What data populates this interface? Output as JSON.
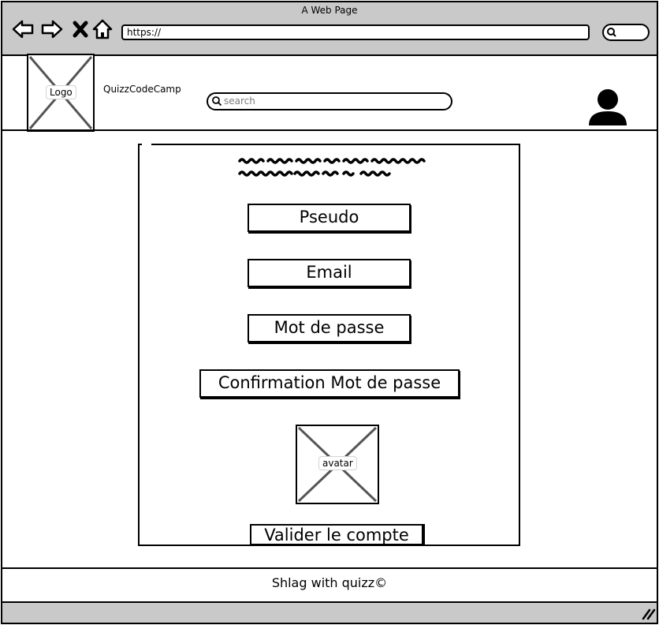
{
  "browser": {
    "title": "A Web Page",
    "url": "https://"
  },
  "header": {
    "logo_label": "Logo",
    "site_name": "QuizzCodeCamp",
    "search_placeholder": "search"
  },
  "form": {
    "fields": {
      "pseudo": "Pseudo",
      "email": "Email",
      "password": "Mot de passe",
      "confirm_password": "Confirmation Mot de passe"
    },
    "avatar_label": "avatar",
    "submit_label": "Valider le compte"
  },
  "footer": {
    "text": "Shlag with quizz©"
  },
  "colors": {
    "chrome": "#c9c9c9",
    "border": "#000000",
    "placeholder_grey": "#7a7a7a"
  },
  "icons": [
    "back-arrow-icon",
    "forward-arrow-icon",
    "close-icon",
    "home-icon",
    "search-icon",
    "user-icon",
    "resize-grip-icon"
  ]
}
